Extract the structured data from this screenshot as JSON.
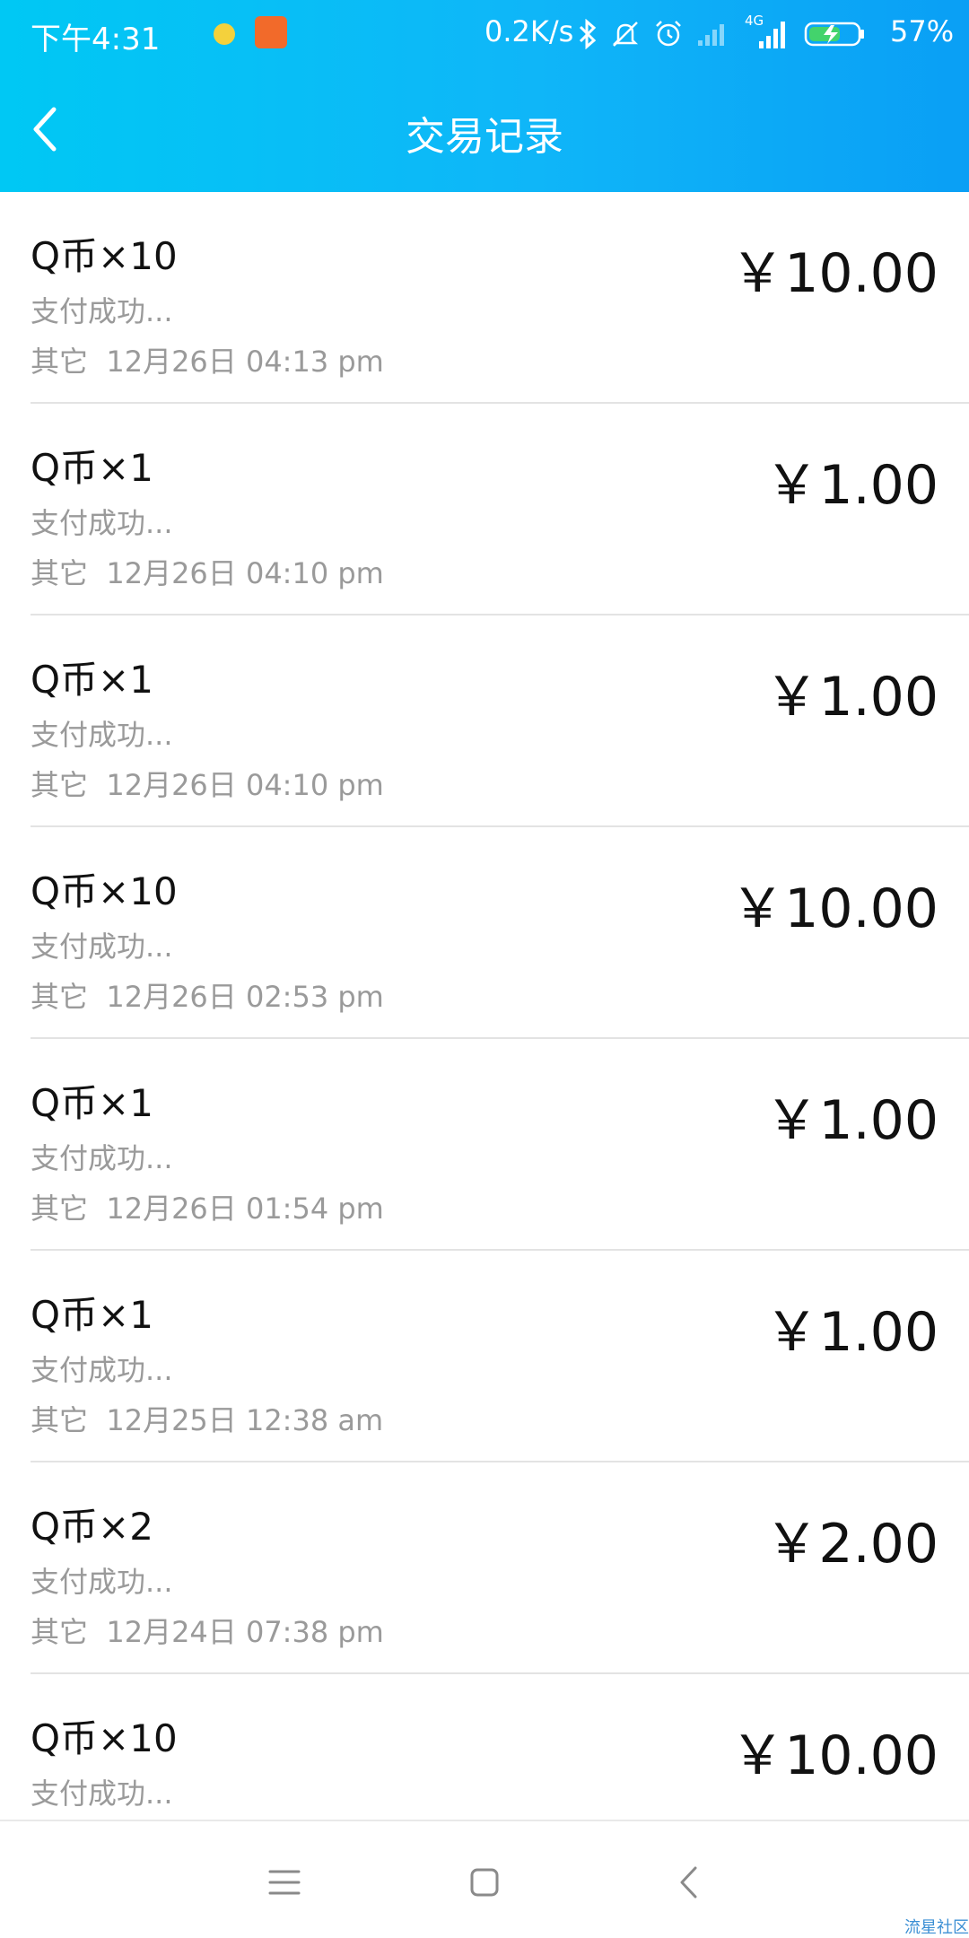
{
  "status_bar": {
    "time": "下午4:31",
    "network_speed": "0.2K/s",
    "network_type": "4G",
    "battery": "57%"
  },
  "header": {
    "title": "交易记录",
    "gradient_colors": [
      "#00c8f4",
      "#0a9ff5"
    ]
  },
  "transactions": [
    {
      "title": "Q币×10",
      "status": "支付成功...",
      "meta": "其它  12月26日 04:13 pm",
      "amount": "￥10.00"
    },
    {
      "title": "Q币×1",
      "status": "支付成功...",
      "meta": "其它  12月26日 04:10 pm",
      "amount": "￥1.00"
    },
    {
      "title": "Q币×1",
      "status": "支付成功...",
      "meta": "其它  12月26日 04:10 pm",
      "amount": "￥1.00"
    },
    {
      "title": "Q币×10",
      "status": "支付成功...",
      "meta": "其它  12月26日 02:53 pm",
      "amount": "￥10.00"
    },
    {
      "title": "Q币×1",
      "status": "支付成功...",
      "meta": "其它  12月26日 01:54 pm",
      "amount": "￥1.00"
    },
    {
      "title": "Q币×1",
      "status": "支付成功...",
      "meta": "其它  12月25日 12:38 am",
      "amount": "￥1.00"
    },
    {
      "title": "Q币×2",
      "status": "支付成功...",
      "meta": "其它  12月24日 07:38 pm",
      "amount": "￥2.00"
    },
    {
      "title": "Q币×10",
      "status": "支付成功...",
      "meta": "",
      "amount": "￥10.00"
    }
  ],
  "watermark": "流星社区",
  "icons": {
    "back": "chevron-left-icon",
    "bluetooth": "bluetooth-icon",
    "mute": "bell-off-icon",
    "alarm": "alarm-icon",
    "signal": "signal-icon",
    "battery": "battery-charging-icon",
    "menu": "menu-icon",
    "home": "home-square-icon",
    "nav_back": "back-arrow-icon"
  }
}
